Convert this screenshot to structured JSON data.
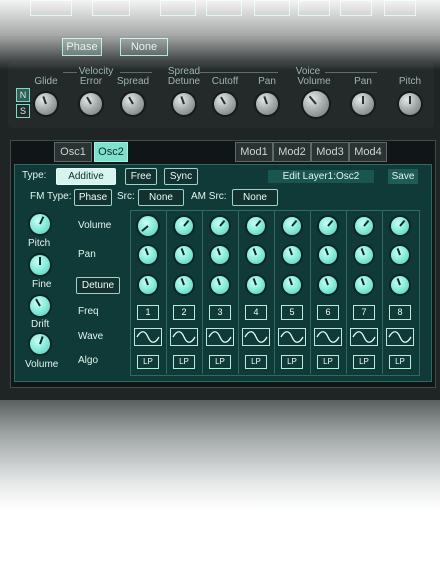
{
  "top": {
    "phase_label": "Phase",
    "none_label": "None"
  },
  "knob_row": {
    "toggle_n": "N",
    "toggle_s": "S",
    "group_velocity": "Velocity",
    "group_spread": "Spread",
    "group_voice": "Voice",
    "labels": [
      "Glide",
      "Error",
      "Spread",
      "Detune",
      "Cutoff",
      "Pan",
      "Volume",
      "Pan",
      "Pitch"
    ]
  },
  "tabs": {
    "osc1": "Osc1",
    "osc2": "Osc2",
    "mod1": "Mod1",
    "mod2": "Mod2",
    "mod3": "Mod3",
    "mod4": "Mod4"
  },
  "osc": {
    "type_label": "Type:",
    "type_value": "Additive",
    "free": "Free",
    "sync": "Sync",
    "edit_title": "Edit Layer1:Osc2",
    "save": "Save",
    "fm_type_label": "FM Type:",
    "fm_type_value": "Phase",
    "src_label": "Src:",
    "src_value": "None",
    "am_src_label": "AM Src:",
    "am_src_value": "None",
    "left_knobs": [
      "Pitch",
      "Fine",
      "Drift",
      "Volume"
    ],
    "row_labels": {
      "volume": "Volume",
      "pan": "Pan",
      "detune": "Detune",
      "freq": "Freq",
      "wave": "Wave",
      "algo": "Algo"
    },
    "freq_values": [
      "1",
      "2",
      "3",
      "4",
      "5",
      "6",
      "7",
      "8"
    ],
    "algo_values": [
      "LP",
      "LP",
      "LP",
      "LP",
      "LP",
      "LP",
      "LP",
      "LP"
    ]
  },
  "colors": {
    "accent": "#7fe0cc",
    "panel": "#0f3a38",
    "background": "#1f2424"
  }
}
